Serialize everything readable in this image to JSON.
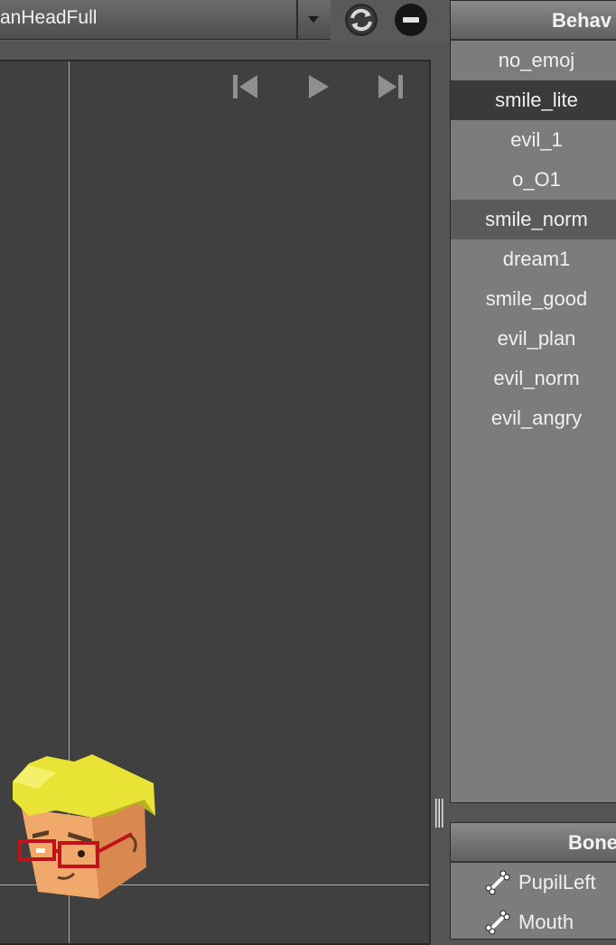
{
  "toolbar": {
    "model_select_value": "anHeadFull",
    "refresh_icon": "refresh-icon",
    "remove_icon": "remove-icon"
  },
  "viewport": {
    "controls": [
      "skip-to-start-icon",
      "play-icon",
      "skip-to-end-icon"
    ]
  },
  "behaviours": {
    "header": "Behav",
    "items": [
      {
        "label": "no_emoj"
      },
      {
        "label": "smile_lite"
      },
      {
        "label": "evil_1"
      },
      {
        "label": "o_O1"
      },
      {
        "label": "smile_norm"
      },
      {
        "label": "dream1"
      },
      {
        "label": "smile_good"
      },
      {
        "label": "evil_plan"
      },
      {
        "label": "evil_norm"
      },
      {
        "label": "evil_angry"
      }
    ],
    "selected_index": 1,
    "highlighted_index": 4
  },
  "bones": {
    "header": "Bone",
    "items": [
      {
        "label": "PupilLeft",
        "icon": "bone-icon"
      },
      {
        "label": "Mouth",
        "icon": "bone-icon"
      }
    ]
  },
  "colors": {
    "background": "#555555",
    "viewport": "#404040",
    "panel": "#7c7c7c",
    "selected_row": "#3a3a3a",
    "highlighted_row": "#5a5a5a",
    "character_hair": "#e8e335",
    "character_skin": "#f0a86b",
    "glasses": "#c0121a"
  }
}
